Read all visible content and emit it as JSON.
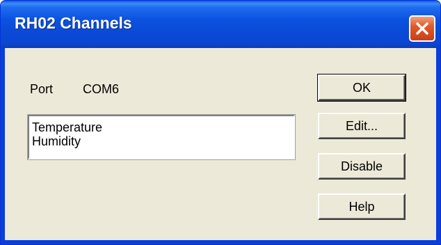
{
  "window": {
    "title": "RH02 Channels"
  },
  "port": {
    "label": "Port",
    "value": "COM6"
  },
  "channels": {
    "items": [
      "Temperature",
      "Humidity"
    ]
  },
  "buttons": {
    "ok": "OK",
    "edit": "Edit...",
    "disable": "Disable",
    "help": "Help"
  },
  "icons": {
    "close": "close-icon"
  },
  "colors": {
    "titlebar": "#0a49d6",
    "dialog_bg": "#ece9d8",
    "close_button": "#e05a2a"
  }
}
